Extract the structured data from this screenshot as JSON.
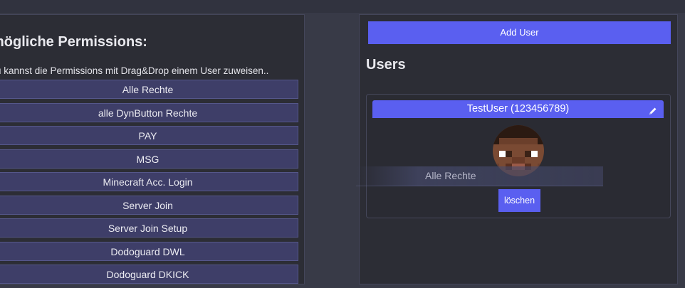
{
  "permissions": {
    "title": "mögliche Permissions:",
    "hint": "u kannst die Permissions mit Drag&Drop einem User zuweisen..",
    "items": [
      "Alle Rechte",
      "alle DynButton Rechte",
      "PAY",
      "MSG",
      "Minecraft Acc. Login",
      "Server Join",
      "Server Join Setup",
      "Dodoguard DWL",
      "Dodoguard DKICK"
    ]
  },
  "users": {
    "add_button_label": "Add User",
    "heading": "Users",
    "cards": [
      {
        "name": "TestUser (123456789)",
        "assigned_permission": "Alle Rechte",
        "delete_label": "löschen"
      }
    ]
  },
  "icons": {
    "edit": "pencil-icon",
    "avatar": "minecraft-skin-head-avatar"
  },
  "colors": {
    "accent": "#5a5ff0",
    "panel": "#2c2d35",
    "background": "#383a47",
    "permission_item": "#3e3e68"
  }
}
